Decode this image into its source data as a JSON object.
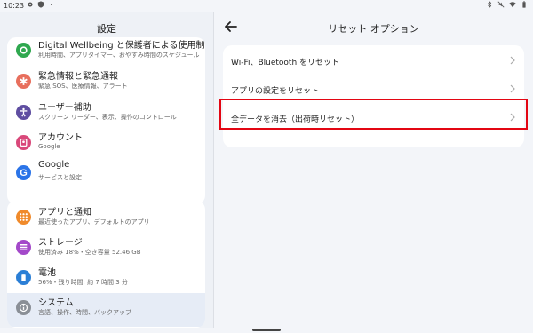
{
  "status_bar": {
    "time": "10:23"
  },
  "left_pane": {
    "title": "設定",
    "group1": [
      {
        "title": "Digital Wellbeing と保護者による使用制限",
        "subtitle": "利用時間、アプリタイマー、おやすみ時間のスケジュール",
        "icon": "wellbeing-icon",
        "color": "#2fa84f"
      },
      {
        "title": "緊急情報と緊急通報",
        "subtitle": "緊急 SOS、医療情報、アラート",
        "icon": "emergency-icon",
        "color": "#e86f5d"
      },
      {
        "title": "ユーザー補助",
        "subtitle": "スクリーン リーダー、表示、操作のコントロール",
        "icon": "accessibility-icon",
        "color": "#5f4ea1"
      },
      {
        "title": "アカウント",
        "subtitle": "Google",
        "icon": "account-icon",
        "color": "#d9487a"
      },
      {
        "title": "Google",
        "subtitle": "サービスと設定",
        "icon": "google-icon",
        "color": "#2b74e8"
      }
    ],
    "group2": [
      {
        "title": "アプリと通知",
        "subtitle": "最近使ったアプリ、デフォルトのアプリ",
        "icon": "apps-icon",
        "color": "#f08a2b"
      },
      {
        "title": "ストレージ",
        "subtitle": "使用済み 18%・空き容量 52.46 GB",
        "icon": "storage-icon",
        "color": "#a349c9"
      },
      {
        "title": "電池",
        "subtitle": "56%・残り時間: 約 7 時間 3 分",
        "icon": "battery-icon",
        "color": "#2b7fd6"
      },
      {
        "title": "システム",
        "subtitle": "言語、操作、時間、バックアップ",
        "icon": "system-icon",
        "color": "#8a8f96",
        "selected": true
      }
    ]
  },
  "right_pane": {
    "title": "リセット オプション",
    "options": [
      {
        "label": "Wi-Fi、Bluetooth をリセット"
      },
      {
        "label": "アプリの設定をリセット"
      },
      {
        "label": "全データを消去（出荷時リセット）"
      }
    ],
    "highlight_color": "#e30613"
  }
}
